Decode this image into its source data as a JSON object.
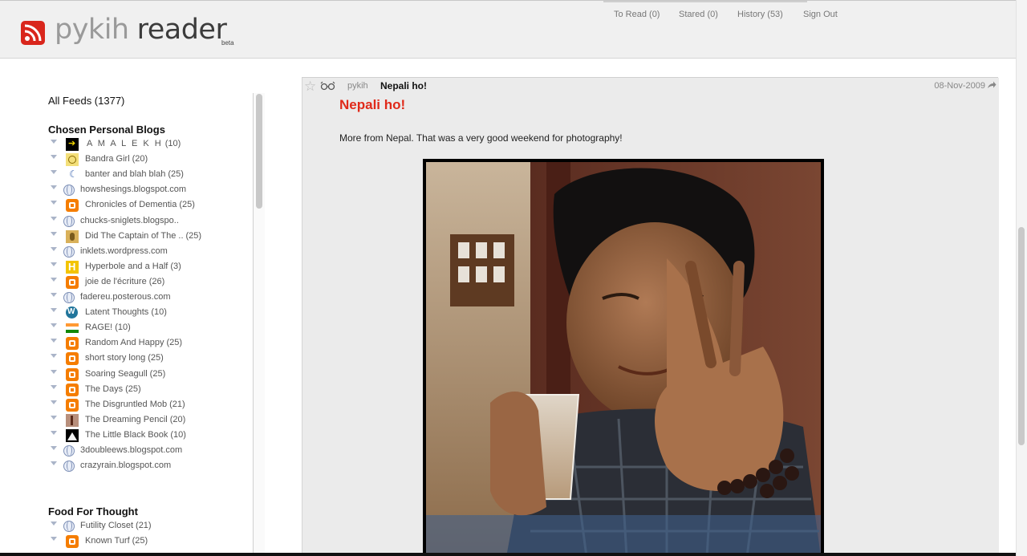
{
  "app": {
    "logo_word1": "pykih",
    "logo_word2": "reader",
    "beta_label": "beta"
  },
  "nav": {
    "to_read": "To Read (0)",
    "stared": "Stared (0)",
    "history": "History (53)",
    "sign_out": "Sign Out"
  },
  "sidebar": {
    "all_feeds": "All Feeds (1377)",
    "categories": [
      {
        "title": "Chosen Personal Blogs",
        "feeds": [
          {
            "label": "A M A L E K H",
            "count": "(10)",
            "icon": "amalekh"
          },
          {
            "label": "Bandra Girl",
            "count": "(20)",
            "icon": "bandra"
          },
          {
            "label": "banter and blah blah",
            "count": "(25)",
            "icon": "moon"
          },
          {
            "label": "howshesings.blogspot.com",
            "count": "",
            "icon": "globe"
          },
          {
            "label": "Chronicles of Dementia",
            "count": "(25)",
            "icon": "blogger"
          },
          {
            "label": "chucks-sniglets.blogspo..",
            "count": "",
            "icon": "globe"
          },
          {
            "label": "Did The Captain of The ..",
            "count": "(25)",
            "icon": "captain"
          },
          {
            "label": "inklets.wordpress.com",
            "count": "",
            "icon": "globe"
          },
          {
            "label": "Hyperbole and a Half",
            "count": "(3)",
            "icon": "hyper"
          },
          {
            "label": "joie de l'écriture",
            "count": "(26)",
            "icon": "blogger"
          },
          {
            "label": "fadereu.posterous.com",
            "count": "",
            "icon": "globe"
          },
          {
            "label": "Latent Thoughts",
            "count": "(10)",
            "icon": "wp"
          },
          {
            "label": "RAGE!",
            "count": "(10)",
            "icon": "flag"
          },
          {
            "label": "Random And Happy",
            "count": "(25)",
            "icon": "blogger"
          },
          {
            "label": "short story long",
            "count": "(25)",
            "icon": "blogger"
          },
          {
            "label": "Soaring Seagull",
            "count": "(25)",
            "icon": "blogger"
          },
          {
            "label": "The Days",
            "count": "(25)",
            "icon": "blogger"
          },
          {
            "label": "The Disgruntled Mob",
            "count": "(21)",
            "icon": "blogger"
          },
          {
            "label": "The Dreaming Pencil",
            "count": "(20)",
            "icon": "pencil"
          },
          {
            "label": "The Little Black Book",
            "count": "(10)",
            "icon": "book"
          },
          {
            "label": "3doubleews.blogspot.com",
            "count": "",
            "icon": "globe"
          },
          {
            "label": "crazyrain.blogspot.com",
            "count": "",
            "icon": "globe"
          }
        ]
      },
      {
        "title": "Food For Thought",
        "feeds": [
          {
            "label": "Futility Closet",
            "count": "(21)",
            "icon": "globe"
          },
          {
            "label": "Known Turf",
            "count": "(25)",
            "icon": "blogger"
          }
        ]
      }
    ]
  },
  "article": {
    "source": "pykih",
    "title_small": "Nepali ho!",
    "date": "08-Nov-2009",
    "headline": "Nepali ho!",
    "body": "More from Nepal. That was a very good weekend for photography!"
  },
  "colors": {
    "headline": "#e02a1a",
    "rss": "#d9261c",
    "blogger": "#f57d00"
  }
}
